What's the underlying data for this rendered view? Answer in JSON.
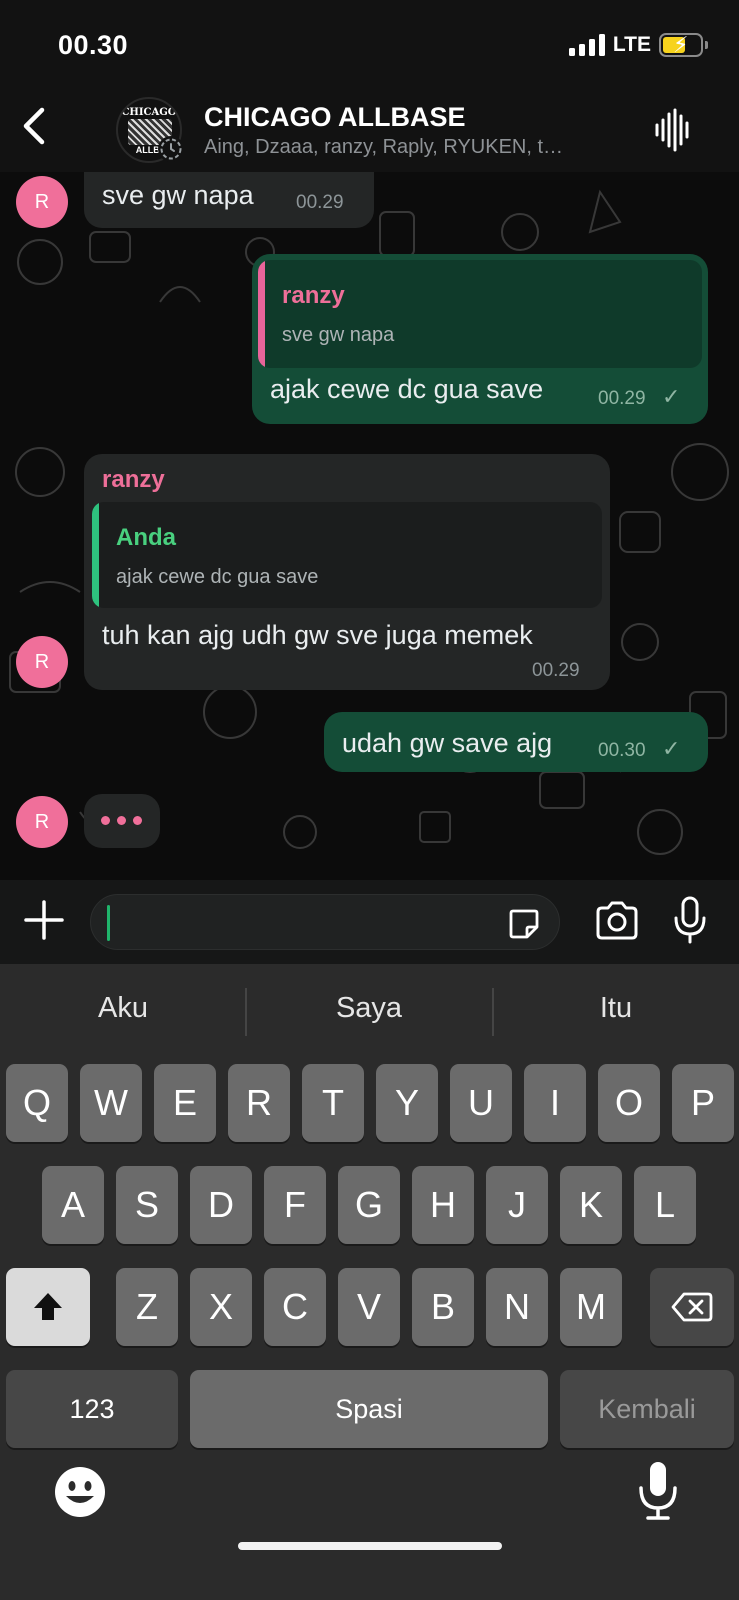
{
  "status_bar": {
    "time": "00.30",
    "network": "LTE"
  },
  "header": {
    "title": "CHICAGO ALLBASE",
    "subtitle": "Aing, Dzaaa, ranzy, Raply, RYUKEN, t…",
    "avatar_logo_top": "CHICAGO",
    "avatar_logo_bottom": "ALLB."
  },
  "messages": [
    {
      "direction": "in",
      "avatar_initial": "R",
      "text": "sve gw napa",
      "time": "00.29"
    },
    {
      "direction": "out",
      "quote": {
        "name": "ranzy",
        "text": "sve gw napa"
      },
      "text": "ajak cewe dc gua save",
      "time": "00.29",
      "status": "✓"
    },
    {
      "direction": "in",
      "avatar_initial": "R",
      "sender": "ranzy",
      "quote": {
        "name": "Anda",
        "text": "ajak cewe dc gua save"
      },
      "text": "tuh kan ajg udh gw sve juga memek",
      "time": "00.29"
    },
    {
      "direction": "out",
      "text": "udah gw save ajg",
      "time": "00.30",
      "status": "✓"
    }
  ],
  "typing": {
    "avatar_initial": "R"
  },
  "composer": {
    "placeholder": ""
  },
  "keyboard": {
    "suggestions": [
      "Aku",
      "Saya",
      "Itu"
    ],
    "row1": [
      "Q",
      "W",
      "E",
      "R",
      "T",
      "Y",
      "U",
      "I",
      "O",
      "P"
    ],
    "row2": [
      "A",
      "S",
      "D",
      "F",
      "G",
      "H",
      "J",
      "K",
      "L"
    ],
    "row3": [
      "Z",
      "X",
      "C",
      "V",
      "B",
      "N",
      "M"
    ],
    "numbers_label": "123",
    "space_label": "Spasi",
    "return_label": "Kembali"
  },
  "colors": {
    "outgoing_bubble": "#144d37",
    "incoming_bubble": "#242626",
    "accent_pink": "#f06f9a",
    "accent_green": "#2ec27e"
  }
}
